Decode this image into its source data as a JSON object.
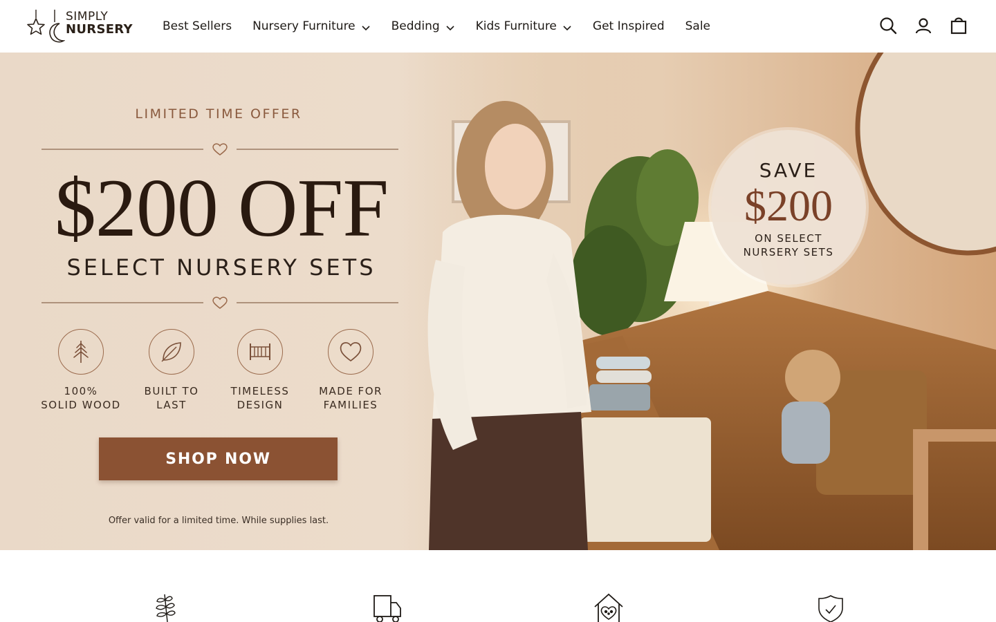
{
  "brand": {
    "name_line1": "SIMPLY",
    "name_line2": "NURSERY"
  },
  "nav": {
    "items": [
      {
        "label": "Best Sellers",
        "has_dropdown": false
      },
      {
        "label": "Nursery Furniture",
        "has_dropdown": true
      },
      {
        "label": "Bedding",
        "has_dropdown": true
      },
      {
        "label": "Kids Furniture",
        "has_dropdown": true
      },
      {
        "label": "Get Inspired",
        "has_dropdown": false
      },
      {
        "label": "Sale",
        "has_dropdown": false
      }
    ],
    "icons": [
      "search-icon",
      "account-icon",
      "cart-icon"
    ]
  },
  "hero": {
    "kicker": "LIMITED TIME OFFER",
    "headline": "$200 OFF",
    "subheadline": "SELECT NURSERY SETS",
    "features": [
      {
        "icon": "tree-icon",
        "line1": "100%",
        "line2": "SOLID WOOD"
      },
      {
        "icon": "leaf-icon",
        "line1": "BUILT TO",
        "line2": "LAST"
      },
      {
        "icon": "crib-icon",
        "line1": "TIMELESS",
        "line2": "DESIGN"
      },
      {
        "icon": "heart-icon",
        "line1": "MADE FOR",
        "line2": "FAMILIES"
      }
    ],
    "cta_label": "SHOP NOW",
    "disclaimer": "Offer valid for a limited time. While supplies last.",
    "badge": {
      "top": "SAVE",
      "amount": "$200",
      "line1": "ON SELECT",
      "line2": "NURSERY SETS"
    }
  },
  "value_props": {
    "icons": [
      "leaf-branch-icon",
      "delivery-truck-icon",
      "family-home-icon",
      "shield-check-icon"
    ]
  },
  "colors": {
    "accent": "#8b5233",
    "badge_amount": "#7a4128",
    "kicker": "#8a5a3e",
    "headline": "#2a1a10",
    "hero_bg": "#ead9c8"
  }
}
